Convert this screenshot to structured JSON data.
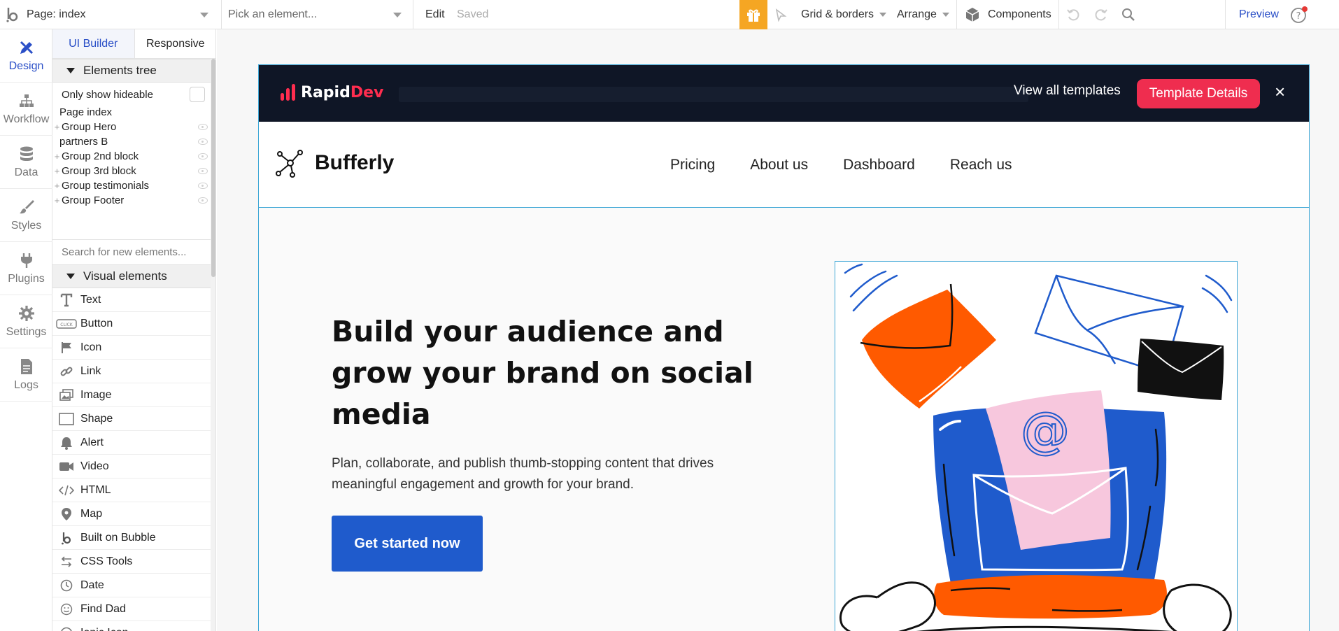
{
  "topbar": {
    "page_selector": "Page: index",
    "element_picker": "Pick an element...",
    "edit": "Edit",
    "saved": "Saved",
    "grid_borders": "Grid & borders",
    "arrange": "Arrange",
    "components": "Components",
    "preview": "Preview"
  },
  "rail": [
    {
      "label": "Design",
      "icon": "pencil-ruler-icon",
      "active": true
    },
    {
      "label": "Workflow",
      "icon": "workflow-icon",
      "active": false
    },
    {
      "label": "Data",
      "icon": "database-icon",
      "active": false
    },
    {
      "label": "Styles",
      "icon": "brush-icon",
      "active": false
    },
    {
      "label": "Plugins",
      "icon": "plug-icon",
      "active": false
    },
    {
      "label": "Settings",
      "icon": "gear-icon",
      "active": false
    },
    {
      "label": "Logs",
      "icon": "document-icon",
      "active": false
    }
  ],
  "panel": {
    "tabs": [
      "UI Builder",
      "Responsive"
    ],
    "elements_tree_title": "Elements tree",
    "only_show_hideable": "Only show hideable",
    "tree": [
      {
        "label": "Page index",
        "expandable": false,
        "eye": false
      },
      {
        "label": "Group Hero",
        "expandable": true,
        "eye": true
      },
      {
        "label": "partners B",
        "expandable": false,
        "eye": true
      },
      {
        "label": "Group 2nd block",
        "expandable": true,
        "eye": true
      },
      {
        "label": "Group 3rd block",
        "expandable": true,
        "eye": true
      },
      {
        "label": "Group testimonials",
        "expandable": true,
        "eye": true
      },
      {
        "label": "Group Footer",
        "expandable": true,
        "eye": true
      }
    ],
    "search_placeholder": "Search for new elements...",
    "visual_elements_title": "Visual elements",
    "visual_elements": [
      {
        "label": "Text",
        "icon": "text-icon"
      },
      {
        "label": "Button",
        "icon": "button-icon"
      },
      {
        "label": "Icon",
        "icon": "flag-icon"
      },
      {
        "label": "Link",
        "icon": "link-icon"
      },
      {
        "label": "Image",
        "icon": "image-icon"
      },
      {
        "label": "Shape",
        "icon": "shape-icon"
      },
      {
        "label": "Alert",
        "icon": "bell-icon"
      },
      {
        "label": "Video",
        "icon": "video-icon"
      },
      {
        "label": "HTML",
        "icon": "code-icon"
      },
      {
        "label": "Map",
        "icon": "map-pin-icon"
      },
      {
        "label": "Built on Bubble",
        "icon": "bubble-logo-icon"
      },
      {
        "label": "CSS Tools",
        "icon": "css-tools-icon"
      },
      {
        "label": "Date",
        "icon": "clock-icon"
      },
      {
        "label": "Find Dad",
        "icon": "smiley-icon"
      },
      {
        "label": "Ionic Icon",
        "icon": "ionic-icon"
      }
    ],
    "button_icon_text": "CLICK"
  },
  "canvas": {
    "rapiddev": {
      "logo_rapid": "Rapid",
      "logo_dev": "Dev",
      "view_all": "View all templates",
      "details_button": "Template Details",
      "close": "×"
    },
    "site": {
      "brand": "Bufferly",
      "nav": [
        "Pricing",
        "About us",
        "Dashboard",
        "Reach us"
      ],
      "hero_title": "Build your audience and grow your brand on social media",
      "hero_subtitle": "Plan, collaborate, and publish thumb-stopping content that drives meaningful engagement and growth for your brand.",
      "cta": "Get started now",
      "illustration_symbol": "@"
    }
  },
  "colors": {
    "bubble_blue": "#2a4fc7",
    "rapiddev_bg": "#0f1626",
    "rapiddev_red": "#ef2d4f",
    "cta_blue": "#1f5bcc",
    "gift_orange": "#f5a623",
    "selection_blue": "#3fa7d6"
  }
}
